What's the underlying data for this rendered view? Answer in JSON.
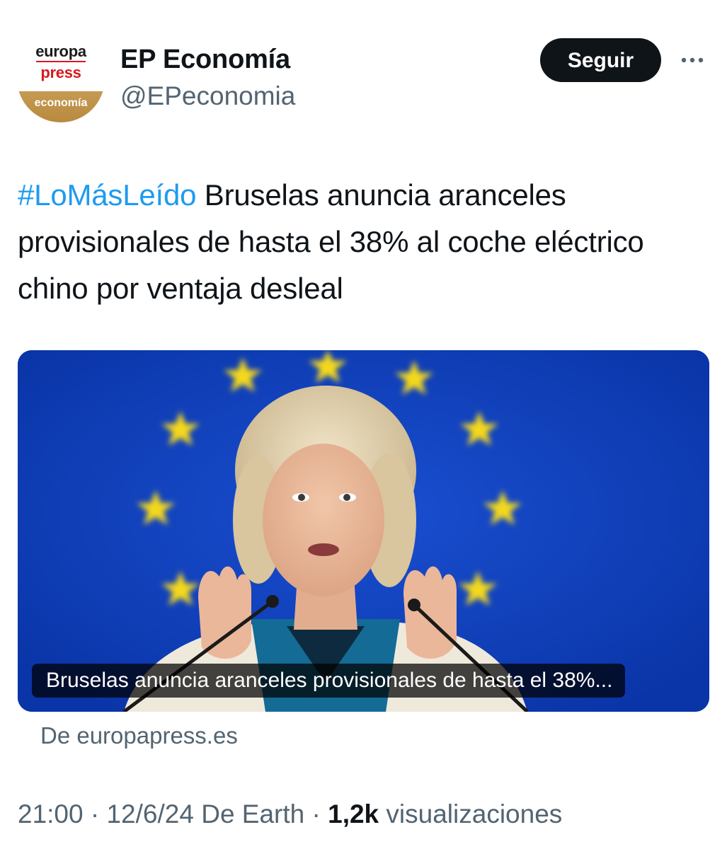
{
  "account": {
    "display_name": "EP Economía",
    "handle": "@EPeconomia",
    "avatar_lines": [
      "europa",
      "press",
      "economía"
    ],
    "follow_label": "Seguir",
    "more_icon": "more-horizontal-icon"
  },
  "tweet": {
    "hashtag": "#LoMásLeído",
    "text": " Bruselas anuncia aranceles provisionales de hasta el 38% al coche eléctrico chino por ventaja desleal"
  },
  "link_card": {
    "caption": "Bruselas anuncia aranceles provisionales de hasta el 38%...",
    "source": "De europapress.es"
  },
  "meta": {
    "time": "21:00",
    "date": "12/6/24",
    "client": "De Earth",
    "views_count": "1,2k",
    "views_label": "visualizaciones",
    "separator": "·"
  },
  "colors": {
    "accent": "#1d9bf0",
    "text": "#0f1419",
    "secondary": "#536471",
    "button_bg": "#0f1419",
    "eu_blue": "#0b3bb0",
    "eu_star": "#f4d81a",
    "brand_red": "#d71920",
    "brand_gold": "#c59a52"
  }
}
